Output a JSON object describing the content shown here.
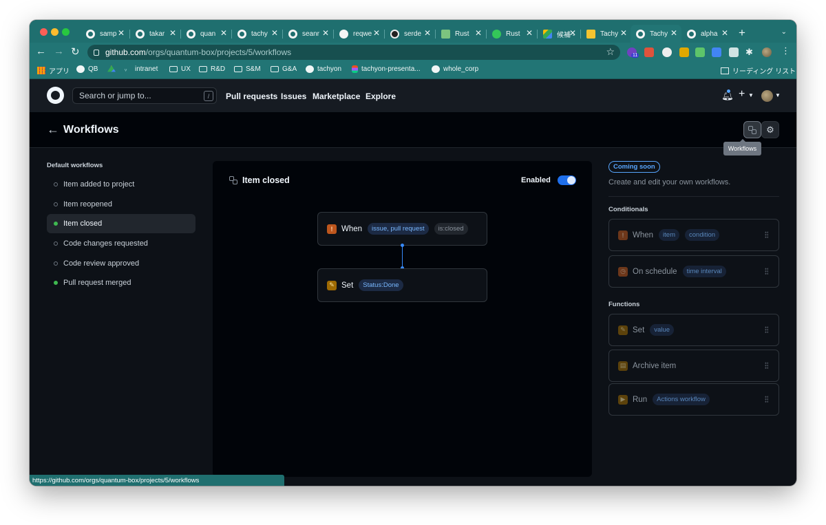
{
  "browser": {
    "tabs": [
      {
        "label": "samp",
        "icon": "github-icon"
      },
      {
        "label": "takar",
        "icon": "github-icon"
      },
      {
        "label": "quan",
        "icon": "github-icon"
      },
      {
        "label": "tachy",
        "icon": "github-icon"
      },
      {
        "label": "seanr",
        "icon": "github-icon"
      },
      {
        "label": "reqwe",
        "icon": "globe-icon"
      },
      {
        "label": "serde",
        "icon": "serde-icon"
      },
      {
        "label": "Rust",
        "icon": "sheets-icon"
      },
      {
        "label": "Rust",
        "icon": "rust-icon"
      },
      {
        "label": "候補 -",
        "icon": "drive-icon"
      },
      {
        "label": "Tachy",
        "icon": "slides-icon"
      },
      {
        "label": "Tachy",
        "icon": "github-icon",
        "active": true
      },
      {
        "label": "alpha",
        "icon": "github-icon"
      }
    ],
    "new_tab": "+",
    "tab_close": "✕",
    "url_host": "github.com",
    "url_path": "/orgs/quantum-box/projects/5/workflows",
    "extension_badge": "11",
    "bookmarks": [
      {
        "label": "アプリ",
        "icon": "apps-grid-icon"
      },
      {
        "label": "QB",
        "icon": "github-icon"
      },
      {
        "label": "",
        "icon": "drive-icon"
      },
      {
        "label": "intranet",
        "icon": "intranet-icon"
      },
      {
        "label": "UX",
        "icon": "folder-icon"
      },
      {
        "label": "R&D",
        "icon": "folder-icon"
      },
      {
        "label": "S&M",
        "icon": "folder-icon"
      },
      {
        "label": "G&A",
        "icon": "folder-icon"
      },
      {
        "label": "tachyon",
        "icon": "github-icon"
      },
      {
        "label": "tachyon-presenta...",
        "icon": "figma-icon"
      },
      {
        "label": "whole_corp",
        "icon": "github-icon"
      }
    ],
    "reading_list": "リーディング リスト",
    "status_url": "https://github.com/orgs/quantum-box/projects/5/workflows"
  },
  "github": {
    "search_placeholder": "Search or jump to...",
    "search_shortcut": "/",
    "nav": [
      "Pull requests",
      "Issues",
      "Marketplace",
      "Explore"
    ]
  },
  "page": {
    "title": "Workflows",
    "tooltip": "Workflows"
  },
  "sidebar": {
    "heading": "Default workflows",
    "items": [
      {
        "label": "Item added to project",
        "enabled": false
      },
      {
        "label": "Item reopened",
        "enabled": false
      },
      {
        "label": "Item closed",
        "enabled": true,
        "selected": true
      },
      {
        "label": "Code changes requested",
        "enabled": false
      },
      {
        "label": "Code review approved",
        "enabled": false
      },
      {
        "label": "Pull request merged",
        "enabled": true
      }
    ]
  },
  "editor": {
    "title": "Item closed",
    "enabled_label": "Enabled",
    "enabled": true,
    "when_node": {
      "label": "When",
      "chips": [
        "issue, pull request",
        "is:closed"
      ]
    },
    "set_node": {
      "label": "Set",
      "chips": [
        "Status:Done"
      ]
    }
  },
  "panel": {
    "badge": "Coming soon",
    "description": "Create and edit your own workflows.",
    "conditionals_heading": "Conditionals",
    "conditionals": [
      {
        "label": "When",
        "chips": [
          "item",
          "condition"
        ]
      },
      {
        "label": "On schedule",
        "chips": [
          "time interval"
        ]
      }
    ],
    "functions_heading": "Functions",
    "functions": [
      {
        "label": "Set",
        "chips": [
          "value"
        ]
      },
      {
        "label": "Archive item",
        "chips": []
      },
      {
        "label": "Run",
        "chips": [
          "Actions workflow"
        ]
      }
    ]
  },
  "colors": {
    "browser_frame": "#1f6f6f",
    "github_bg": "#0d1117",
    "accent_blue": "#1f6feb",
    "enabled_green": "#3fb950"
  }
}
